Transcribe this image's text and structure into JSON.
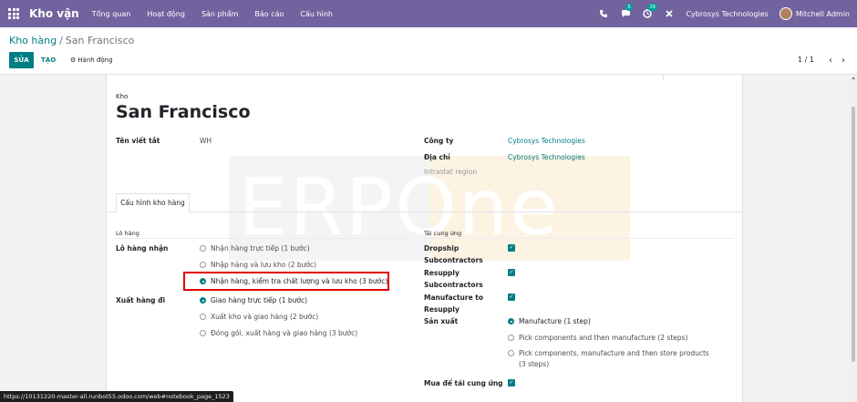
{
  "navbar": {
    "brand": "Kho vận",
    "menu": [
      "Tổng quan",
      "Hoạt động",
      "Sản phẩm",
      "Báo cáo",
      "Cấu hình"
    ],
    "chat_badge": "5",
    "activity_badge": "29",
    "company": "Cybrosys Technologies",
    "user": "Mitchell Admin"
  },
  "control_panel": {
    "breadcrumb_parent": "Kho hàng",
    "breadcrumb_separator": "/",
    "breadcrumb_current": "San Francisco",
    "edit_label": "SỬA",
    "create_label": "TẠO",
    "action_label": "Hành động",
    "pager": "1 / 1"
  },
  "form": {
    "record_label": "Kho",
    "name": "San Francisco",
    "short_name_label": "Tên viết tắt",
    "short_name_value": "WH",
    "company_label": "Công ty",
    "company_value": "Cybrosys Technologies",
    "address_label": "Địa chỉ",
    "address_value": "Cybrosys Technologies",
    "intrastat_placeholder": "Intrastat region",
    "watermark": "ERPOne"
  },
  "tab": {
    "label": "Cấu hình kho hàng"
  },
  "shipments": {
    "section_title": "Lô hàng",
    "incoming_label": "Lô hàng nhận",
    "incoming_options": [
      "Nhận hàng trực tiếp (1 bước)",
      "Nhập hàng và lưu kho (2 bước)",
      "Nhận hàng, kiểm tra chất lượng và lưu kho (3 bước)"
    ],
    "incoming_selected": 2,
    "outgoing_label": "Xuất hàng đi",
    "outgoing_options": [
      "Giao hàng trực tiếp (1 bước)",
      "Xuất kho và giao hàng (2 bước)",
      "Đóng gói, xuất hàng và giao hàng (3 bước)"
    ],
    "outgoing_selected": 0
  },
  "resupply": {
    "section_title": "Tái cung ứng",
    "dropship_label_1": "Dropship",
    "dropship_label_2": "Subcontractors",
    "resupply_sub_label_1": "Resupply",
    "resupply_sub_label_2": "Subcontractors",
    "manufacture_resupply_label_1": "Manufacture to",
    "manufacture_resupply_label_2": "Resupply",
    "manufacture_label": "Sản xuất",
    "manufacture_options": [
      "Manufacture (1 step)",
      "Pick components and then manufacture (2 steps)",
      "Pick components, manufacture and then store products",
      "(3 steps)"
    ],
    "manufacture_selected": 0,
    "buy_resupply_label": "Mua để tái cung ứng"
  },
  "status_url": "https://10131220-master-all.runbot55.odoo.com/web#notebook_page_1523",
  "colors": {
    "navbar": "#71639e",
    "accent": "#017e84",
    "highlight": "#e00000"
  }
}
